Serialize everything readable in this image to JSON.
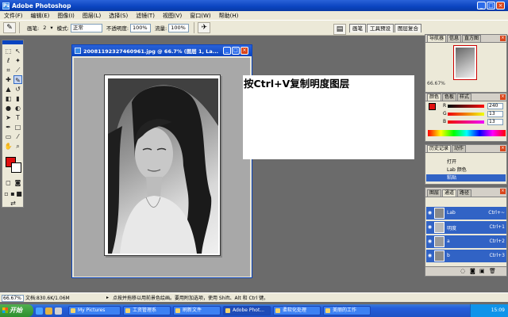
{
  "window": {
    "title": "Adobe Photoshop"
  },
  "menu": [
    "文件(F)",
    "编辑(E)",
    "图像(I)",
    "图层(L)",
    "选择(S)",
    "滤镜(T)",
    "视图(V)",
    "窗口(W)",
    "帮助(H)"
  ],
  "options": {
    "brush_label": "画笔:",
    "brush_size": "2",
    "mode_label": "模式:",
    "mode_value": "正常",
    "opacity_label": "不透明度:",
    "opacity_value": "100%",
    "flow_label": "流量:",
    "flow_value": "100%"
  },
  "palette_well": [
    "画笔",
    "工具预设",
    "图层复合"
  ],
  "document": {
    "title": "20081192327460961.jpg @ 66.7% (图层 1, La..."
  },
  "annotation": "按Ctrl+V复制明度图层",
  "navigator": {
    "tabs": [
      "导航器",
      "信息",
      "直方图"
    ],
    "zoom": "66.67%"
  },
  "color_panel": {
    "tabs": [
      "颜色",
      "色板",
      "样式"
    ],
    "channels": [
      {
        "label": "R",
        "value": "240"
      },
      {
        "label": "G",
        "value": "13"
      },
      {
        "label": "B",
        "value": "13"
      }
    ],
    "foreground": "#e01010"
  },
  "history_panel": {
    "tabs": [
      "历史记录",
      "动作"
    ],
    "items": [
      "打开",
      "Lab 颜色",
      "粘贴"
    ]
  },
  "layers_panel": {
    "tabs": [
      "图层",
      "通道",
      "路径"
    ],
    "rows": [
      {
        "name": "Lab",
        "shortcut": "Ctrl+~"
      },
      {
        "name": "明度",
        "shortcut": "Ctrl+1"
      },
      {
        "name": "a",
        "shortcut": "Ctrl+2"
      },
      {
        "name": "b",
        "shortcut": "Ctrl+3"
      }
    ]
  },
  "statusbar": {
    "zoom": "66.67%",
    "doc_size": "文档:830.6K/1.06M",
    "hint": "点按并拖移以用前景色绘画。要用附加选项，使用 Shift、Alt 和 Ctrl 键。"
  },
  "taskbar": {
    "start": "开始",
    "tasks": [
      "My Pictures",
      "工资管理系",
      "刷新文件",
      "Adobe Phot...",
      "柔软化处理",
      "美丽的工作"
    ],
    "active_task": 3,
    "clock": "15:09"
  }
}
